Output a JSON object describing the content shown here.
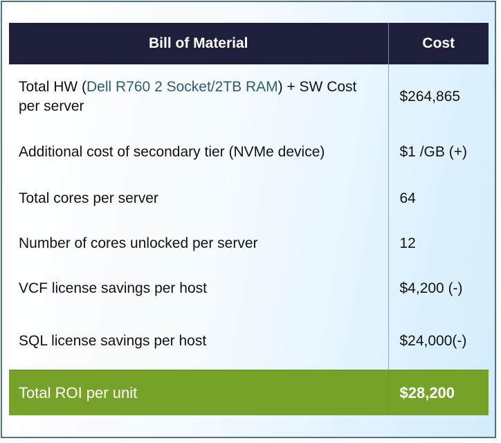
{
  "table": {
    "header": {
      "item": "Bill of Material",
      "cost": "Cost"
    },
    "rows": [
      {
        "pre": "Total HW (",
        "highlight": "Dell R760 2 Socket/2TB RAM",
        "post": ") + SW Cost per server",
        "cost": "$264,865"
      },
      {
        "item": "Additional cost of secondary tier (NVMe device)",
        "cost": "$1 /GB (+)"
      },
      {
        "item": "Total cores per server",
        "cost": "64"
      },
      {
        "item": "Number of cores unlocked per server",
        "cost": "12"
      },
      {
        "item": "VCF license savings per host",
        "cost": "$4,200 (-)"
      },
      {
        "item": "SQL license savings per host",
        "cost": "$24,000(-)"
      }
    ],
    "total": {
      "item": "Total ROI per unit",
      "cost": "$28,200"
    }
  },
  "colors": {
    "header_bg": "#1e1f3b",
    "total_bg": "#76a22a",
    "highlight_text": "#2e5c6e",
    "frame_border": "#4a6f8f"
  }
}
